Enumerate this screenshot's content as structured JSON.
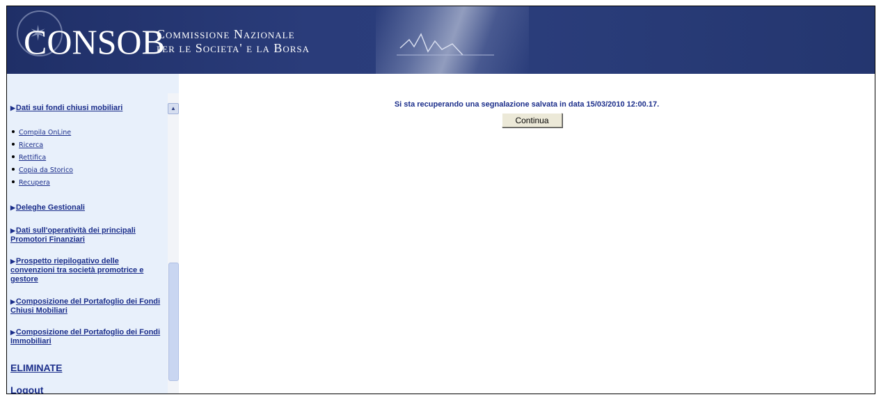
{
  "header": {
    "logo_text": "CONSOB",
    "subtitle_line1": "Commissione Nazionale",
    "subtitle_line2": "per le Societa' e la Borsa"
  },
  "sidebar": {
    "items": [
      {
        "type": "section",
        "label": "Dati sui fondi chiusi mobiliari"
      },
      {
        "type": "link",
        "label": "Compila OnLine"
      },
      {
        "type": "link",
        "label": "Ricerca"
      },
      {
        "type": "link",
        "label": "Rettifica"
      },
      {
        "type": "link",
        "label": "Copia da Storico"
      },
      {
        "type": "link",
        "label": "Recupera"
      },
      {
        "type": "section",
        "label": "Deleghe Gestionali"
      },
      {
        "type": "section",
        "label": "Dati sull'operatività dei principali Promotori Finanziari"
      },
      {
        "type": "section",
        "label": "Prospetto riepilogativo delle convenzioni tra società promotrice e gestore"
      },
      {
        "type": "section",
        "label": "Composizione del Portafoglio dei Fondi Chiusi Mobiliari"
      },
      {
        "type": "section",
        "label": "Composizione del Portafoglio dei Fondi Immobiliari"
      },
      {
        "type": "big",
        "label": "ELIMINATE"
      },
      {
        "type": "big",
        "label": "Logout"
      }
    ],
    "scrollbar": {
      "up_icon": "arrow-up-icon",
      "down_icon": "arrow-down-icon"
    }
  },
  "main": {
    "message": "Si sta recuperando una segnalazione salvata in data 15/03/2010 12:00.17.",
    "continue_button": "Continua"
  },
  "colors": {
    "banner": "#2a3c7a",
    "sidebar_bg": "#e8f0fb",
    "link": "#1a2d8a"
  }
}
